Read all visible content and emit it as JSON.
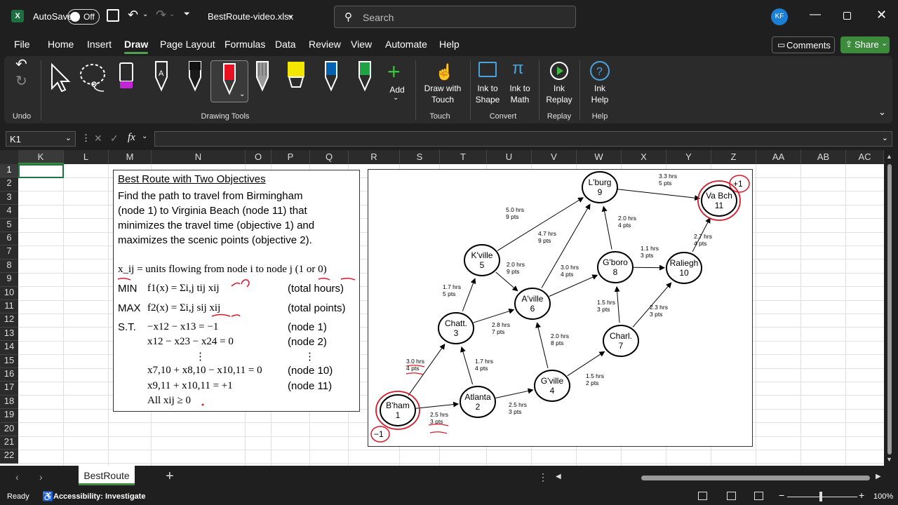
{
  "titlebar": {
    "autosave_label": "AutoSave",
    "autosave_state": "Off",
    "filename": "BestRoute-video.xlsx",
    "search_placeholder": "Search",
    "avatar_initials": "KF"
  },
  "menu": {
    "items": [
      "File",
      "Home",
      "Insert",
      "Draw",
      "Page Layout",
      "Formulas",
      "Data",
      "Review",
      "View",
      "Automate",
      "Help"
    ],
    "active": "Draw",
    "comments": "Comments",
    "share": "Share"
  },
  "ribbon": {
    "undo_group": "Undo",
    "drawing_tools_group": "Drawing Tools",
    "add_label": "Add",
    "draw_with_touch": "Draw with\nTouch",
    "touch_group": "Touch",
    "ink_to_shape": "Ink to\nShape",
    "ink_to_math": "Ink to\nMath",
    "convert_group": "Convert",
    "ink_replay": "Ink\nReplay",
    "replay_group": "Replay",
    "ink_help": "Ink\nHelp",
    "help_group": "Help",
    "pen_colors": [
      "#c026d3",
      "#ffffff",
      "#111111",
      "#e81123",
      "#9a9a9a",
      "#f2e600",
      "#0063b1",
      "#1fa345"
    ]
  },
  "formula": {
    "cell_ref": "K1",
    "fx": "fx",
    "value": ""
  },
  "columns": [
    "K",
    "L",
    "M",
    "N",
    "O",
    "P",
    "Q",
    "R",
    "S",
    "T",
    "U",
    "V",
    "W",
    "X",
    "Y",
    "Z",
    "AA",
    "AB",
    "AC"
  ],
  "rows": [
    "1",
    "2",
    "3",
    "4",
    "5",
    "6",
    "7",
    "8",
    "9",
    "10",
    "11",
    "12",
    "13",
    "14",
    "15",
    "16",
    "17",
    "18",
    "19",
    "20",
    "21",
    "22"
  ],
  "textbox": {
    "heading": "Best Route with Two Objectives",
    "para": [
      "Find the path to travel from Birmingham",
      "(node 1) to Virginia Beach (node 11) that",
      "minimizes the travel time (objective 1) and",
      "maximizes the scenic points (objective 2)."
    ],
    "var_def": "x_ij = units flowing from node i to node j (1 or 0)",
    "min_label": "MIN",
    "min_expr": "f1(x) = Σi,j tij xij",
    "min_note": "(total hours)",
    "max_label": "MAX",
    "max_expr": "f2(x) = Σi,j sij xij",
    "max_note": "(total points)",
    "st_label": "S.T.",
    "constraints": [
      {
        "expr": "−x12 − x13 = −1",
        "note": "(node 1)"
      },
      {
        "expr": "x12 − x23 − x24 = 0",
        "note": "(node 2)"
      },
      {
        "expr": "⋮",
        "note": "⋮"
      },
      {
        "expr": "x7,10 + x8,10 − x10,11 = 0",
        "note": "(node 10)"
      },
      {
        "expr": "x9,11 + x10,11 = +1",
        "note": "(node 11)"
      },
      {
        "expr": "All xij ≥ 0",
        "note": ""
      }
    ]
  },
  "network": {
    "nodes": [
      {
        "id": "1",
        "name": "B'ham",
        "num": "1"
      },
      {
        "id": "2",
        "name": "Atlanta",
        "num": "2"
      },
      {
        "id": "3",
        "name": "Chatt.",
        "num": "3"
      },
      {
        "id": "4",
        "name": "G'ville",
        "num": "4"
      },
      {
        "id": "5",
        "name": "K'ville",
        "num": "5"
      },
      {
        "id": "6",
        "name": "A'ville",
        "num": "6"
      },
      {
        "id": "7",
        "name": "Charl.",
        "num": "7"
      },
      {
        "id": "8",
        "name": "G'boro",
        "num": "8"
      },
      {
        "id": "9",
        "name": "L'burg",
        "num": "9"
      },
      {
        "id": "10",
        "name": "Raliegh",
        "num": "10"
      },
      {
        "id": "11",
        "name": "Va Bch",
        "num": "11"
      }
    ],
    "edges": [
      {
        "from": "1",
        "to": "2",
        "hrs": "2.5 hrs",
        "pts": "3 pts"
      },
      {
        "from": "1",
        "to": "3",
        "hrs": "3.0 hrs",
        "pts": "4 pts"
      },
      {
        "from": "2",
        "to": "3",
        "hrs": "1.7 hrs",
        "pts": "4 pts"
      },
      {
        "from": "2",
        "to": "4",
        "hrs": "2.5 hrs",
        "pts": "3 pts"
      },
      {
        "from": "3",
        "to": "5",
        "hrs": "1.7 hrs",
        "pts": "5 pts"
      },
      {
        "from": "3",
        "to": "6",
        "hrs": "2.8 hrs",
        "pts": "7 pts"
      },
      {
        "from": "4",
        "to": "6",
        "hrs": "2.0 hrs",
        "pts": "8 pts"
      },
      {
        "from": "4",
        "to": "7",
        "hrs": "1.5 hrs",
        "pts": "2 pts"
      },
      {
        "from": "5",
        "to": "6",
        "hrs": "2.0 hrs",
        "pts": "9 pts"
      },
      {
        "from": "5",
        "to": "9",
        "hrs": "5.0 hrs",
        "pts": "9 pts"
      },
      {
        "from": "6",
        "to": "8",
        "hrs": "3.0 hrs",
        "pts": "4 pts"
      },
      {
        "from": "6",
        "to": "9",
        "hrs": "4.7 hrs",
        "pts": "9 pts"
      },
      {
        "from": "7",
        "to": "8",
        "hrs": "1.5 hrs",
        "pts": "3 pts"
      },
      {
        "from": "7",
        "to": "10",
        "hrs": "2.3 hrs",
        "pts": "3 pts"
      },
      {
        "from": "8",
        "to": "9",
        "hrs": "2.0 hrs",
        "pts": "4 pts"
      },
      {
        "from": "8",
        "to": "10",
        "hrs": "1.1 hrs",
        "pts": "3 pts"
      },
      {
        "from": "9",
        "to": "11",
        "hrs": "3.3 hrs",
        "pts": "5 pts"
      },
      {
        "from": "10",
        "to": "11",
        "hrs": "2.7 hrs",
        "pts": "4 pts"
      }
    ],
    "supply": "−1",
    "demand": "+1"
  },
  "sheet": {
    "tab": "BestRoute"
  },
  "status": {
    "ready": "Ready",
    "accessibility": "Accessibility: Investigate",
    "zoom": "100%"
  }
}
